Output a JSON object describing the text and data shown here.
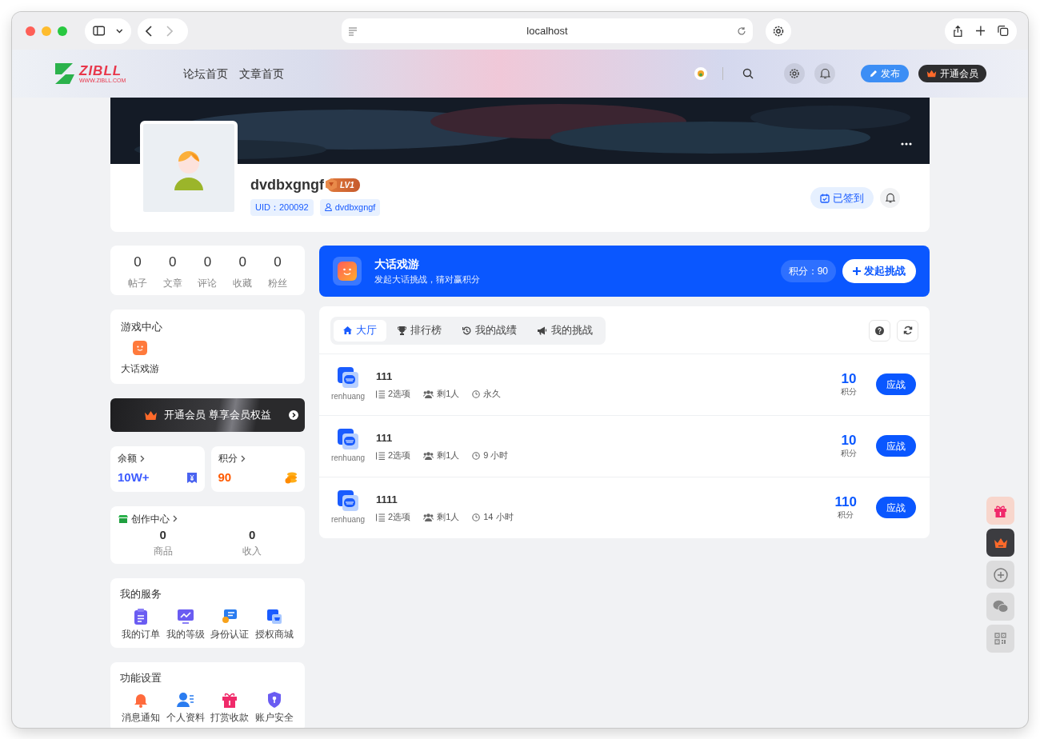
{
  "browser": {
    "url": "localhost"
  },
  "header": {
    "logo": {
      "name": "ZIBLL",
      "site": "WWW.ZIBLL.COM"
    },
    "nav": [
      {
        "label": "论坛首页"
      },
      {
        "label": "文章首页"
      }
    ],
    "publish": "发布",
    "vip": "开通会员"
  },
  "profile": {
    "username": "dvdbxgngf",
    "level": "LV1",
    "uid": "UID：200092",
    "handle": "dvdbxgngf",
    "checkin": {
      "label": "已签到",
      "checked": true
    }
  },
  "stats": [
    {
      "value": "0",
      "label": "帖子"
    },
    {
      "value": "0",
      "label": "文章"
    },
    {
      "value": "0",
      "label": "评论"
    },
    {
      "value": "0",
      "label": "收藏"
    },
    {
      "value": "0",
      "label": "粉丝"
    }
  ],
  "game_center": {
    "title": "游戏中心",
    "items": [
      {
        "label": "大话戏游"
      }
    ]
  },
  "vip_banner": "开通会员 尊享会员权益",
  "wallet": [
    {
      "kind": "balance",
      "label": "余额",
      "value": "10W+"
    },
    {
      "kind": "points",
      "label": "积分",
      "value": "90"
    }
  ],
  "creator": {
    "title": "创作中心",
    "stats": [
      {
        "value": "0",
        "label": "商品"
      },
      {
        "value": "0",
        "label": "收入"
      }
    ]
  },
  "services": {
    "title": "我的服务",
    "items": [
      {
        "kind": "order",
        "label": "我的订单"
      },
      {
        "kind": "level",
        "label": "我的等级"
      },
      {
        "kind": "identity",
        "label": "身份认证"
      },
      {
        "kind": "shop",
        "label": "授权商城"
      }
    ]
  },
  "settings": {
    "title": "功能设置",
    "items": [
      {
        "kind": "bell",
        "label": "消息通知"
      },
      {
        "kind": "user",
        "label": "个人资料"
      },
      {
        "kind": "gift",
        "label": "打赏收款"
      },
      {
        "kind": "shield",
        "label": "账户安全"
      }
    ]
  },
  "game": {
    "title": "大话戏游",
    "subtitle": "发起大话挑战，猜对赢积分",
    "points": "积分：90",
    "create": "发起挑战"
  },
  "tabs": [
    {
      "kind": "home",
      "label": "大厅",
      "selected": true
    },
    {
      "kind": "trophy",
      "label": "排行榜",
      "selected": false
    },
    {
      "kind": "history",
      "label": "我的战绩",
      "selected": false
    },
    {
      "kind": "megaphone",
      "label": "我的挑战",
      "selected": false
    }
  ],
  "challenges": [
    {
      "author": "renhuang",
      "title": "111",
      "options": "2选项",
      "remaining": "剩1人",
      "time": "永久",
      "reward": "10",
      "reward_unit": "积分",
      "action": "应战"
    },
    {
      "author": "renhuang",
      "title": "111",
      "options": "2选项",
      "remaining": "剩1人",
      "time": "9 小时",
      "reward": "10",
      "reward_unit": "积分",
      "action": "应战"
    },
    {
      "author": "renhuang",
      "title": "1111",
      "options": "2选项",
      "remaining": "剩1人",
      "time": "14 小时",
      "reward": "110",
      "reward_unit": "积分",
      "action": "应战"
    }
  ]
}
